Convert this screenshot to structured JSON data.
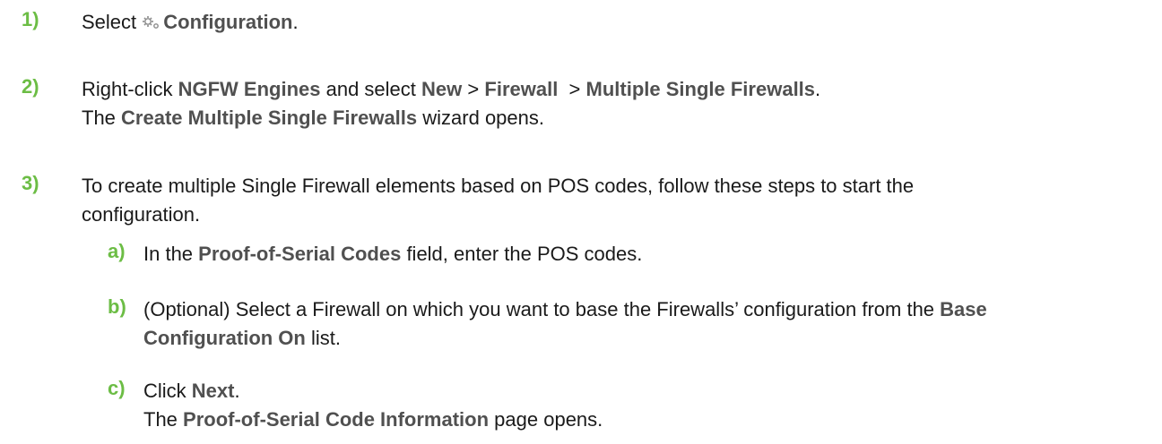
{
  "steps": [
    {
      "num": "1)",
      "select": "Select",
      "configuration": "Configuration",
      "period": "."
    },
    {
      "num": "2)",
      "t1": "Right-click",
      "ngfw": "NGFW Engines",
      "t2": "and select",
      "new": "New",
      "gt1": ">",
      "firewall": "Firewall",
      "gt2": ">",
      "multi": "Multiple Single Firewalls",
      "period": ".",
      "l2a": "The",
      "wizard": "Create Multiple Single Firewalls",
      "l2b": "wizard opens."
    },
    {
      "num": "3)",
      "line1": "To create multiple Single Firewall elements based on POS codes, follow these steps to start the",
      "line2": "configuration."
    }
  ],
  "substeps": [
    {
      "num": "a)",
      "t1": "In the",
      "field": "Proof-of-Serial Codes",
      "t2": "field, enter the POS codes."
    },
    {
      "num": "b)",
      "t1": "(Optional) Select a Firewall on which you want to base the Firewalls’ configuration from the",
      "base1": "Base",
      "base2": "Configuration On",
      "t2": "list."
    },
    {
      "num": "c)",
      "t1": "Click",
      "next": "Next",
      "period": ".",
      "l2a": "The",
      "page": "Proof-of-Serial Code Information",
      "l2b": "page opens."
    }
  ],
  "icons": {
    "configuration": "gear-icon"
  },
  "colors": {
    "step_number": "#6cbd45",
    "ui_text": "#505050",
    "body_text": "#1a1a1a"
  }
}
